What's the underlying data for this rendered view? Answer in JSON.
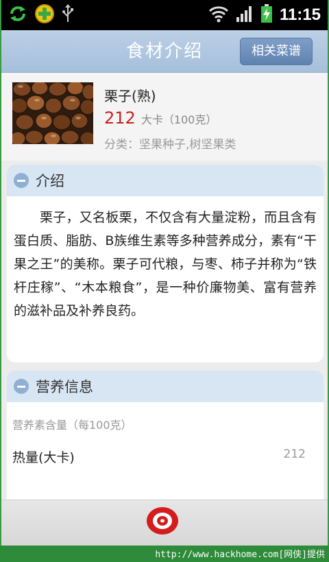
{
  "status_bar": {
    "time": "11:15"
  },
  "header": {
    "title": "食材介绍",
    "recipe_button": "相关菜谱"
  },
  "food": {
    "name": "栗子(熟)",
    "calories": "212",
    "calorie_unit": "大卡（100克）",
    "category": "分类：坚果种子,树坚果类"
  },
  "intro": {
    "title": "介绍",
    "text": "栗子，又名板栗，不仅含有大量淀粉，而且含有蛋白质、脂肪、B族维生素等多种营养成分，素有“干果之王”的美称。栗子可代粮，与枣、柿子并称为“铁杆庄稼”、“木本粮食”，是一种价廉物美、富有营养的滋补品及补养良药。"
  },
  "nutrition": {
    "title": "营养信息",
    "sub_label": "营养素含量（每100克）",
    "rows": [
      {
        "name": "热量(大卡)",
        "value": "212"
      }
    ]
  },
  "watermark": "http://www.hackhome.com[网侠]提供",
  "colors": {
    "accent": "#c8201e",
    "header": "#a6bfdb",
    "section_head": "#d8e6f4",
    "frame": "#2e8b3a"
  }
}
